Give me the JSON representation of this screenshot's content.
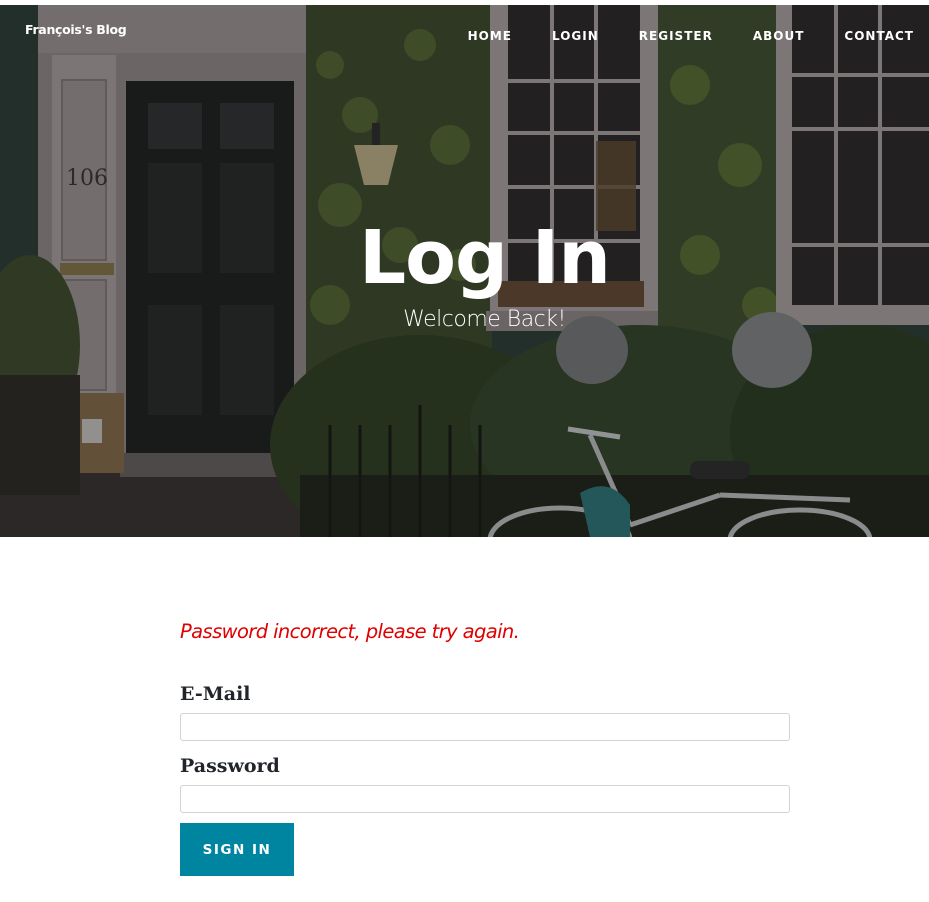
{
  "navbar": {
    "brand": "François's Blog",
    "links": [
      "HOME",
      "LOGIN",
      "REGISTER",
      "ABOUT",
      "CONTACT"
    ]
  },
  "header": {
    "title": "Log In",
    "subtitle": "Welcome Back!",
    "house_number": "106"
  },
  "form": {
    "flash_message": "Password incorrect, please try again.",
    "email_label": "E-Mail",
    "email_value": "",
    "password_label": "Password",
    "password_value": "",
    "submit_label": "SIGN IN"
  },
  "colors": {
    "accent": "#0085a1",
    "error": "#e00000",
    "text": "#212529"
  },
  "icons": {
    "hero_image": "house-facade-with-bicycle-image"
  }
}
